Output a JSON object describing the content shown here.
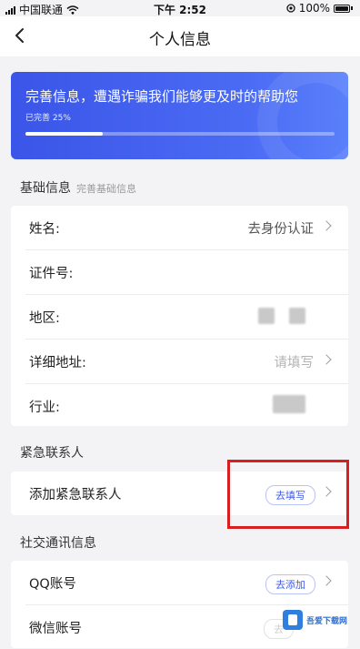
{
  "status_bar": {
    "carrier": "中国联通",
    "time": "下午 2:52",
    "battery": "100%"
  },
  "nav": {
    "title": "个人信息"
  },
  "banner": {
    "title": "完善信息，遭遇诈骗我们能够更及时的帮助您",
    "progress_text": "已完善 25%",
    "progress": 0.25
  },
  "basic_info": {
    "header": "基础信息",
    "sub": "完善基础信息",
    "rows": [
      {
        "label": "姓名:",
        "value": "去身份认证"
      },
      {
        "label": "证件号:",
        "value": ""
      },
      {
        "label": "地区:",
        "value": ""
      },
      {
        "label": "详细地址:",
        "value": "请填写"
      },
      {
        "label": "行业:",
        "value": ""
      }
    ]
  },
  "emergency": {
    "header": "紧急联系人",
    "row_label": "添加紧急联系人",
    "button": "去填写"
  },
  "social": {
    "header": "社交通讯信息",
    "rows": [
      {
        "label": "QQ账号",
        "button": "去添加"
      },
      {
        "label": "微信账号",
        "button": "去"
      }
    ]
  },
  "watermark": {
    "text": "吾爱下载网"
  },
  "colors": {
    "accent": "#3f5ae8",
    "banner": "#4b6bf4",
    "highlight": "#d81e1e"
  }
}
